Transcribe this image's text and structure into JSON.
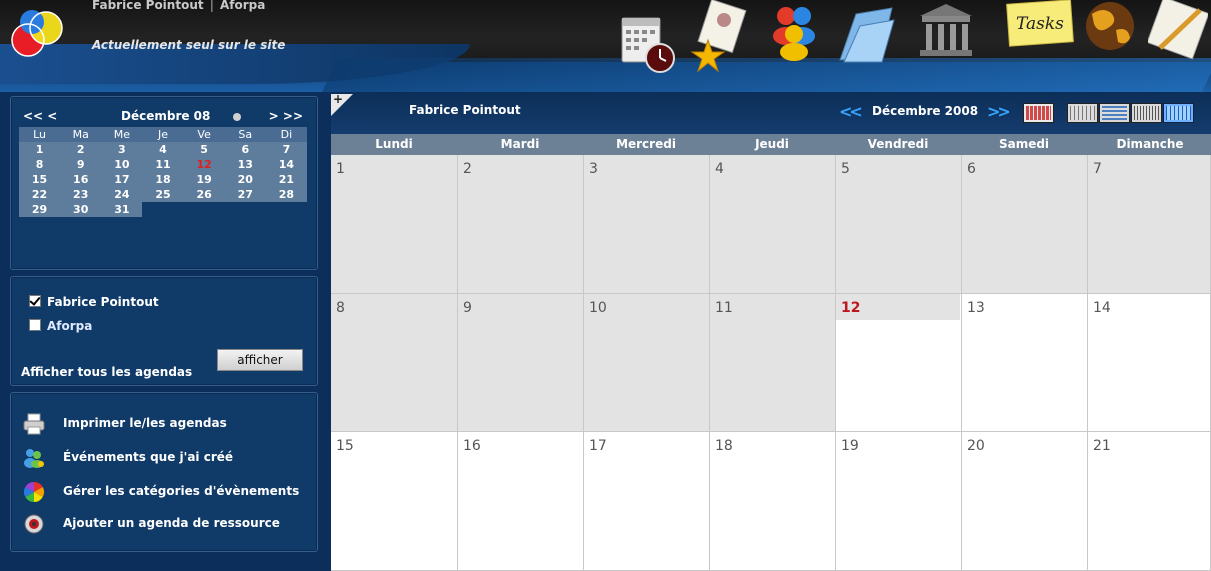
{
  "header": {
    "user_name": "Fabrice Pointout",
    "org_name": "Aforpa",
    "status_text": "Actuellement seul sur le site",
    "tasks_label": "Tasks",
    "app_icons": [
      "calendar-clock-icon",
      "favorites-star-icon",
      "users-icon",
      "folder-icon",
      "building-icon",
      "tasks-icon",
      "globe-icon",
      "notepad-icon"
    ]
  },
  "mini_calendar": {
    "prev": "<< <",
    "month_label": "Décembre 08",
    "next": "> >>",
    "weekdays": [
      "Lu",
      "Ma",
      "Me",
      "Je",
      "Ve",
      "Sa",
      "Di"
    ],
    "weeks": [
      [
        "1",
        "2",
        "3",
        "4",
        "5",
        "6",
        "7"
      ],
      [
        "8",
        "9",
        "10",
        "11",
        "12",
        "13",
        "14"
      ],
      [
        "15",
        "16",
        "17",
        "18",
        "19",
        "20",
        "21"
      ],
      [
        "22",
        "23",
        "24",
        "25",
        "26",
        "27",
        "28"
      ],
      [
        "29",
        "30",
        "31",
        "",
        "",
        "",
        ""
      ]
    ],
    "today": "12"
  },
  "agendas": {
    "items": [
      {
        "label": "Fabrice Pointout",
        "checked": true
      },
      {
        "label": "Aforpa",
        "checked": false
      }
    ],
    "show_all_label": "Afficher tous les agendas",
    "show_button": "afficher"
  },
  "actions": [
    {
      "label": "Imprimer le/les agendas",
      "icon": "printer-icon"
    },
    {
      "label": "Événements que j'ai créé",
      "icon": "users-events-icon"
    },
    {
      "label": "Gérer les catégories d'évènements",
      "icon": "color-wheel-icon"
    },
    {
      "label": "Ajouter un agenda de ressource",
      "icon": "resource-icon"
    }
  ],
  "calendar": {
    "owner": "Fabrice Pointout",
    "title": "Décembre 2008",
    "prev_arrow": "<<",
    "next_arrow": ">>",
    "add_symbol": "+",
    "day_names": [
      "Lundi",
      "Mardi",
      "Mercredi",
      "Jeudi",
      "Vendredi",
      "Samedi",
      "Dimanche"
    ],
    "weeks": [
      [
        "1",
        "2",
        "3",
        "4",
        "5",
        "6",
        "7"
      ],
      [
        "8",
        "9",
        "10",
        "11",
        "12",
        "13",
        "14"
      ],
      [
        "15",
        "16",
        "17",
        "18",
        "19",
        "20",
        "21"
      ]
    ],
    "today": "12",
    "views": [
      "day-view-icon",
      "week-view-icon",
      "month-view-icon",
      "year-view-icon",
      "multi-view-icon"
    ]
  },
  "colors": {
    "background": "#0b2f5a",
    "panel": "#103a68",
    "today_red": "#c0161d",
    "arrow_blue": "#37a6ff",
    "past_day": "#e3e3e3"
  }
}
